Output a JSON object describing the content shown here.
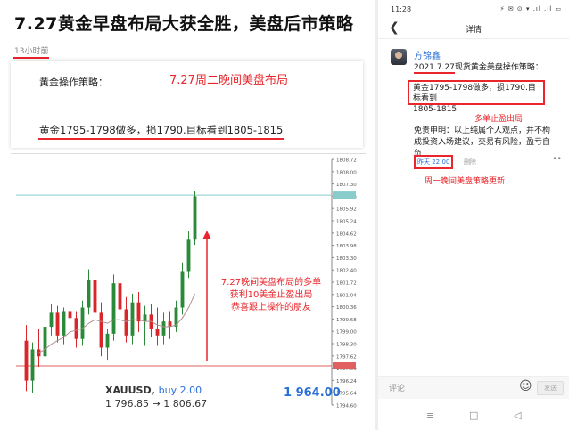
{
  "left": {
    "title": "7.27黄金早盘布局大获全胜，美盘后市策略",
    "time_ago": "13小时前",
    "strategy_label": "黄金操作策略：",
    "red_note": "7.27周二晚间美盘布局",
    "strategy_line": "黄金1795-1798做多，损1790.目标看到1805-1815",
    "annotation": [
      "7.27晚间美盘布局的多单",
      "获利10美金止盈出局",
      "恭喜跟上操作的朋友"
    ],
    "symbol": "XAUUSD,",
    "buy_label": "buy 2.00",
    "price_range": "1 796.85 → 1 806.67",
    "profit": "1 964.00"
  },
  "chart_data": {
    "type": "candlestick",
    "y_ticks": [
      "1808.72",
      "1808.00",
      "1807.30",
      "1806.60",
      "1805.92",
      "1805.24",
      "1804.62",
      "1803.98",
      "1803.30",
      "1802.40",
      "1801.72",
      "1801.04",
      "1800.36",
      "1799.68",
      "1799.00",
      "1798.30",
      "1797.62",
      "1797.00",
      "1796.24",
      "1795.64",
      "1794.60"
    ],
    "ylim": [
      1794.6,
      1808.72
    ],
    "entry_price": 1796.85,
    "exit_price": 1806.67,
    "colors": {
      "up": "#2a8a3a",
      "down": "#d9262b",
      "ma": "#b09090",
      "entry_line": "#e06060",
      "exit_line": "#88cccc"
    },
    "candles": [
      {
        "o": 1798.3,
        "h": 1799.2,
        "l": 1795.4,
        "c": 1796.0
      },
      {
        "o": 1796.0,
        "h": 1798.2,
        "l": 1795.3,
        "c": 1797.8
      },
      {
        "o": 1797.8,
        "h": 1799.0,
        "l": 1796.8,
        "c": 1797.4
      },
      {
        "o": 1797.4,
        "h": 1799.6,
        "l": 1796.9,
        "c": 1799.1
      },
      {
        "o": 1799.1,
        "h": 1800.4,
        "l": 1798.6,
        "c": 1799.9
      },
      {
        "o": 1799.9,
        "h": 1800.3,
        "l": 1798.2,
        "c": 1798.6
      },
      {
        "o": 1798.6,
        "h": 1800.2,
        "l": 1798.1,
        "c": 1800.0
      },
      {
        "o": 1800.0,
        "h": 1801.2,
        "l": 1799.3,
        "c": 1799.6
      },
      {
        "o": 1799.6,
        "h": 1800.0,
        "l": 1797.9,
        "c": 1798.4
      },
      {
        "o": 1798.4,
        "h": 1800.6,
        "l": 1798.0,
        "c": 1800.2
      },
      {
        "o": 1800.2,
        "h": 1802.4,
        "l": 1799.8,
        "c": 1801.8
      },
      {
        "o": 1801.8,
        "h": 1802.2,
        "l": 1799.4,
        "c": 1799.9
      },
      {
        "o": 1799.9,
        "h": 1800.5,
        "l": 1797.4,
        "c": 1797.9
      },
      {
        "o": 1797.9,
        "h": 1799.0,
        "l": 1797.2,
        "c": 1798.7
      },
      {
        "o": 1798.7,
        "h": 1802.1,
        "l": 1798.3,
        "c": 1801.6
      },
      {
        "o": 1801.6,
        "h": 1801.9,
        "l": 1799.5,
        "c": 1800.1
      },
      {
        "o": 1800.1,
        "h": 1800.8,
        "l": 1798.2,
        "c": 1798.6
      },
      {
        "o": 1798.6,
        "h": 1801.0,
        "l": 1798.1,
        "c": 1800.5
      },
      {
        "o": 1800.5,
        "h": 1801.1,
        "l": 1798.8,
        "c": 1799.4
      },
      {
        "o": 1799.4,
        "h": 1800.3,
        "l": 1798.0,
        "c": 1799.8
      },
      {
        "o": 1799.8,
        "h": 1800.4,
        "l": 1798.5,
        "c": 1799.0
      },
      {
        "o": 1799.0,
        "h": 1800.2,
        "l": 1798.0,
        "c": 1798.6
      },
      {
        "o": 1798.6,
        "h": 1799.9,
        "l": 1798.1,
        "c": 1799.4
      },
      {
        "o": 1799.4,
        "h": 1800.0,
        "l": 1798.4,
        "c": 1799.1
      },
      {
        "o": 1799.1,
        "h": 1800.6,
        "l": 1798.8,
        "c": 1800.2
      },
      {
        "o": 1800.2,
        "h": 1802.8,
        "l": 1799.8,
        "c": 1802.3
      },
      {
        "o": 1802.3,
        "h": 1804.6,
        "l": 1801.9,
        "c": 1804.1
      },
      {
        "o": 1804.1,
        "h": 1806.9,
        "l": 1803.8,
        "c": 1806.6
      }
    ],
    "ma": [
      1797.6,
      1797.6,
      1797.6,
      1797.8,
      1798.1,
      1798.3,
      1798.5,
      1798.8,
      1798.9,
      1799.0,
      1799.3,
      1799.5,
      1799.4,
      1799.3,
      1799.5,
      1799.5,
      1799.4,
      1799.5,
      1799.5,
      1799.4,
      1799.4,
      1799.2,
      1799.1,
      1799.1,
      1799.2,
      1799.6,
      1800.2,
      1801.0
    ]
  },
  "right": {
    "status_time": "11:28",
    "status_icons": "⚡ ✉ ⊙ ▾ .ıl .ıl ▭",
    "nav_title": "详情",
    "author": "方锦鑫",
    "post_date": "2021.7.27",
    "post_title_rest": "现货黄金美盘操作策略：",
    "box_line1": "黄金1795-1798做多，损1790.目标看到",
    "box_line2": "1805-1815",
    "red_mid": "多单止盈出局",
    "disclaimer": "免责申明：以上纯属个人观点，并不构成投资入场建议，交易有风险，盈亏自负",
    "post_time": "昨天 22:00",
    "delete_label": "删除",
    "more": "••",
    "red_bottom": "周一晚间美盘策略更新",
    "comment_placeholder": "评论",
    "send_label": "发送",
    "sysnav": [
      "≡",
      "□",
      "◁"
    ]
  }
}
